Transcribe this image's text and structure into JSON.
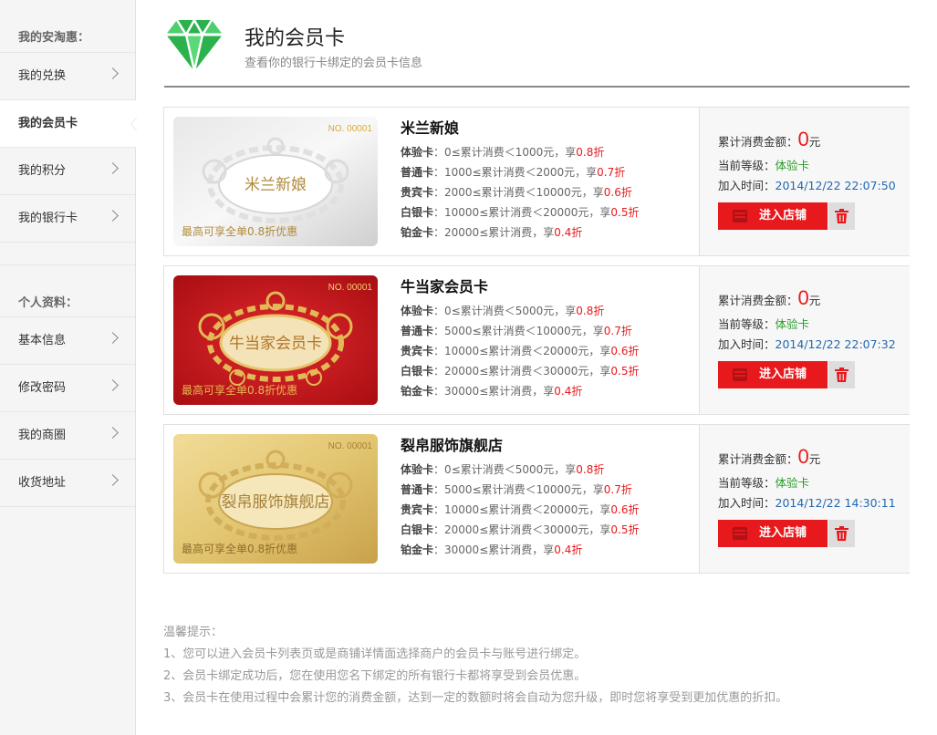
{
  "sidebar": {
    "section1_title": "我的安淘惠：",
    "section1_items": [
      {
        "label": "我的兑换"
      },
      {
        "label": "我的会员卡"
      },
      {
        "label": "我的积分"
      },
      {
        "label": "我的银行卡"
      }
    ],
    "section2_title": "个人资料：",
    "section2_items": [
      {
        "label": "基本信息"
      },
      {
        "label": "修改密码"
      },
      {
        "label": "我的商圈"
      },
      {
        "label": "收货地址"
      }
    ]
  },
  "header": {
    "title": "我的会员卡",
    "subtitle": "查看你的银行卡绑定的会员卡信息",
    "icon": "diamond-icon",
    "icon_color": "#2bb24c"
  },
  "labels": {
    "spend_label": "累计消费金额：",
    "currency_unit": "元",
    "level_label": "当前等级：",
    "join_label": "加入时间：",
    "enter_button": "进入店铺",
    "delete_icon": "trash-icon"
  },
  "cards": [
    {
      "store_name": "米兰新娘",
      "card_title": "米兰新娘",
      "card_no": "NO. 00001",
      "card_promo": "最高可享全单0.8折优惠",
      "card_style": "silver",
      "tiers": [
        {
          "name": "体验卡",
          "rule": "：0≤累计消费＜1000元，享",
          "discount": "0.8折"
        },
        {
          "name": "普通卡",
          "rule": "：1000≤累计消费＜2000元，享",
          "discount": "0.7折"
        },
        {
          "name": "贵宾卡",
          "rule": "：2000≤累计消费＜10000元，享",
          "discount": "0.6折"
        },
        {
          "name": "白银卡",
          "rule": "：10000≤累计消费＜20000元，享",
          "discount": "0.5折"
        },
        {
          "name": "铂金卡",
          "rule": "：20000≤累计消费，享",
          "discount": "0.4折"
        }
      ],
      "amount": "0",
      "level": "体验卡",
      "join_time": "2014/12/22 22:07:50"
    },
    {
      "store_name": "牛当家会员卡",
      "card_title": "牛当家会员卡",
      "card_no": "NO. 00001",
      "card_promo": "最高可享全单0.8折优惠",
      "card_style": "red",
      "tiers": [
        {
          "name": "体验卡",
          "rule": "：0≤累计消费＜5000元，享",
          "discount": "0.8折"
        },
        {
          "name": "普通卡",
          "rule": "：5000≤累计消费＜10000元，享",
          "discount": "0.7折"
        },
        {
          "name": "贵宾卡",
          "rule": "：10000≤累计消费＜20000元，享",
          "discount": "0.6折"
        },
        {
          "name": "白银卡",
          "rule": "：20000≤累计消费＜30000元，享",
          "discount": "0.5折"
        },
        {
          "name": "铂金卡",
          "rule": "：30000≤累计消费，享",
          "discount": "0.4折"
        }
      ],
      "amount": "0",
      "level": "体验卡",
      "join_time": "2014/12/22 22:07:32"
    },
    {
      "store_name": "裂帛服饰旗舰店",
      "card_title": "裂帛服饰旗舰店",
      "card_no": "NO. 00001",
      "card_promo": "最高可享全单0.8折优惠",
      "card_style": "gold",
      "tiers": [
        {
          "name": "体验卡",
          "rule": "：0≤累计消费＜5000元，享",
          "discount": "0.8折"
        },
        {
          "name": "普通卡",
          "rule": "：5000≤累计消费＜10000元，享",
          "discount": "0.7折"
        },
        {
          "name": "贵宾卡",
          "rule": "：10000≤累计消费＜20000元，享",
          "discount": "0.6折"
        },
        {
          "name": "白银卡",
          "rule": "：20000≤累计消费＜30000元，享",
          "discount": "0.5折"
        },
        {
          "name": "铂金卡",
          "rule": "：30000≤累计消费，享",
          "discount": "0.4折"
        }
      ],
      "amount": "0",
      "level": "体验卡",
      "join_time": "2014/12/22 14:30:11"
    }
  ],
  "tips": {
    "title": "温馨提示：",
    "lines": [
      "1、您可以进入会员卡列表页或是商铺详情面选择商户的会员卡与账号进行绑定。",
      "2、会员卡绑定成功后，您在使用您名下绑定的所有银行卡都将享受到会员优惠。",
      "3、会员卡在使用过程中会累计您的消费金额，达到一定的数额时将会自动为您升级，即时您将享受到更加优惠的折扣。"
    ]
  },
  "colors": {
    "accent_red": "#e8191c",
    "level_green": "#2a9d2a",
    "date_blue": "#2168b3",
    "silver": "#d9d9d9",
    "red": "#c5161b",
    "gold": "#d9b95f"
  }
}
